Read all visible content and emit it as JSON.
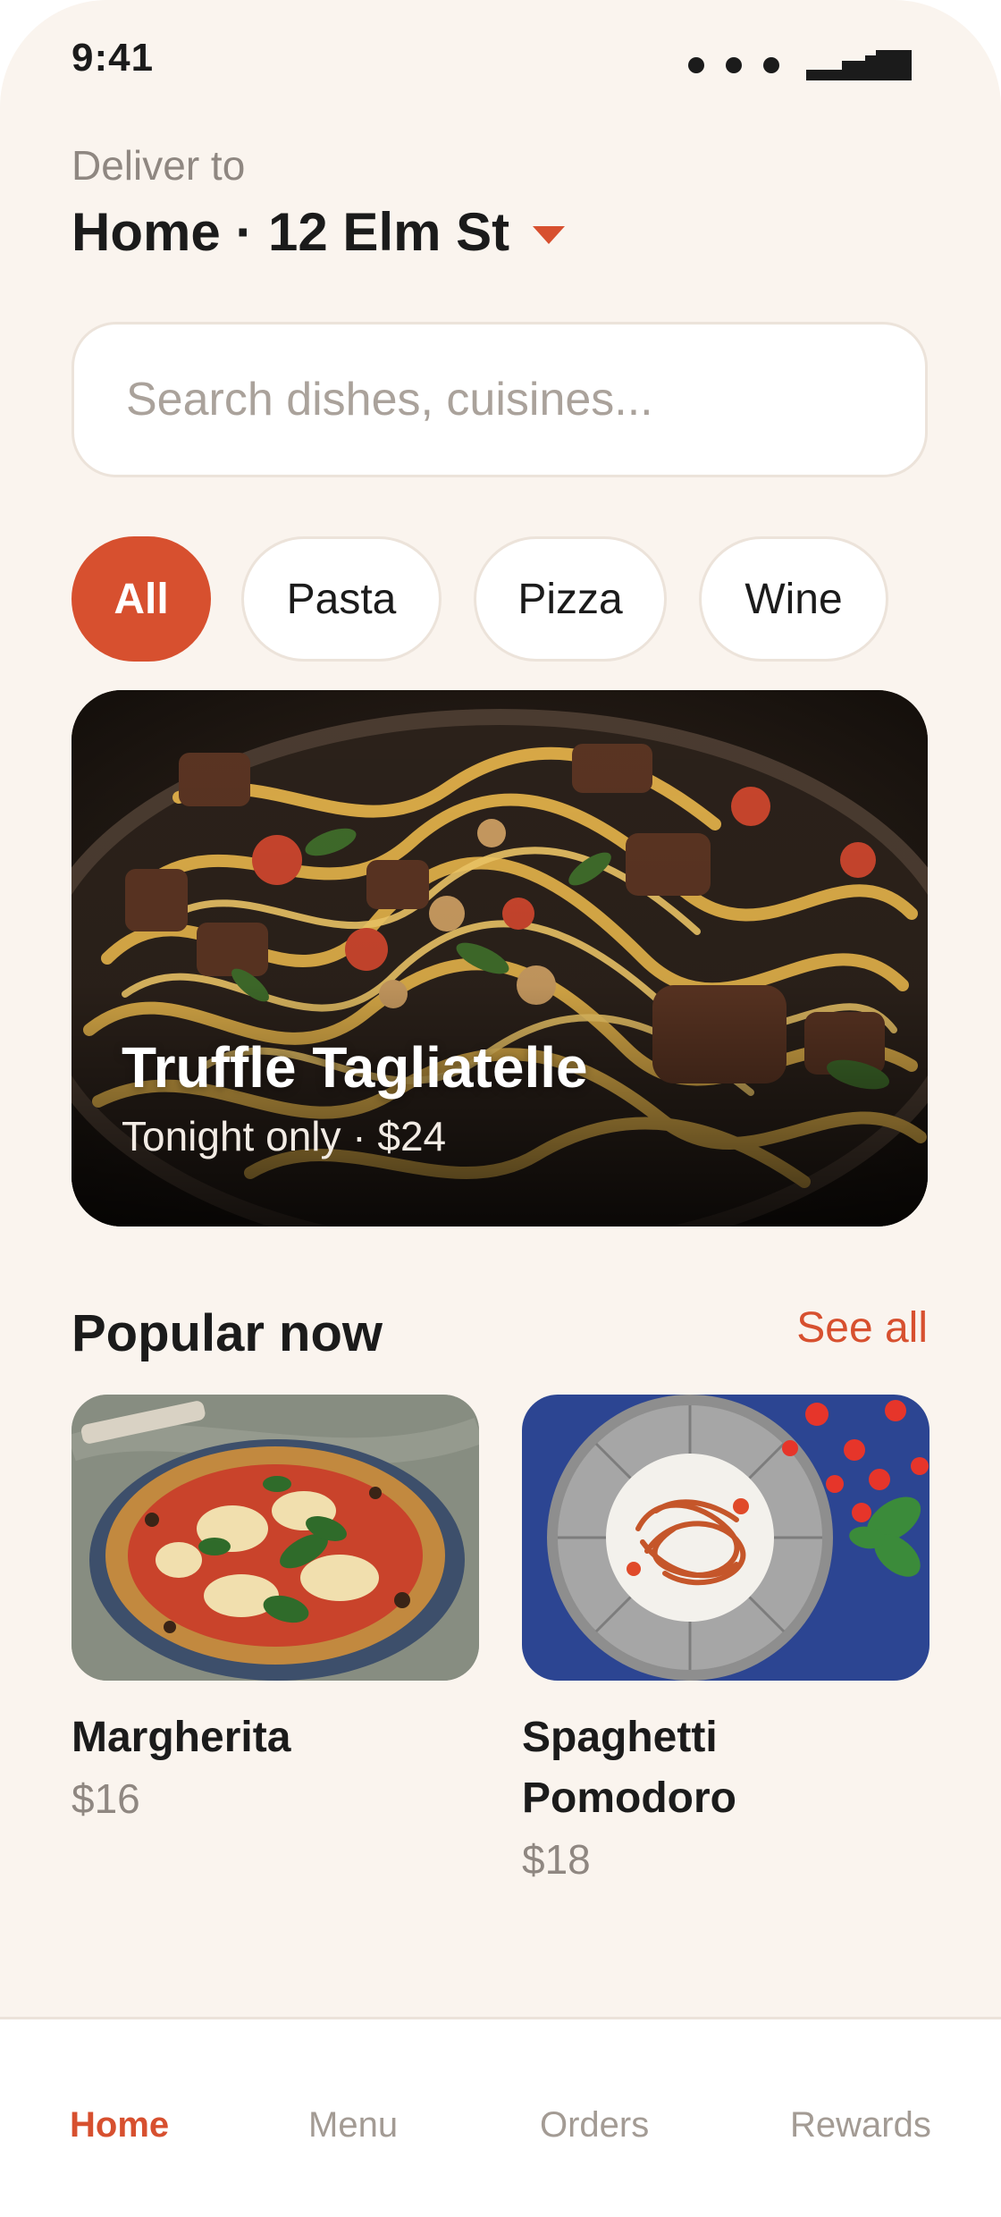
{
  "status_bar": {
    "time": "9:41"
  },
  "deliver": {
    "label": "Deliver to",
    "address": "Home · 12 Elm St"
  },
  "search": {
    "placeholder": "Search dishes, cuisines..."
  },
  "categories": [
    {
      "label": "All",
      "active": true
    },
    {
      "label": "Pasta",
      "active": false
    },
    {
      "label": "Pizza",
      "active": false
    },
    {
      "label": "Wine",
      "active": false
    }
  ],
  "featured": {
    "title": "Truffle Tagliatelle",
    "subtitle": "Tonight only · $24"
  },
  "popular": {
    "title": "Popular now",
    "see_all": "See all",
    "items": [
      {
        "name": "Margherita",
        "price": "$16"
      },
      {
        "name": "Spaghetti Pomodoro",
        "price": "$18"
      }
    ]
  },
  "nav": {
    "items": [
      {
        "label": "Home",
        "active": true
      },
      {
        "label": "Menu",
        "active": false
      },
      {
        "label": "Orders",
        "active": false
      },
      {
        "label": "Rewards",
        "active": false
      }
    ]
  },
  "colors": {
    "accent": "#d7502f",
    "background": "#faf4ee",
    "text": "#1b1b1b",
    "muted": "#8f8781"
  }
}
